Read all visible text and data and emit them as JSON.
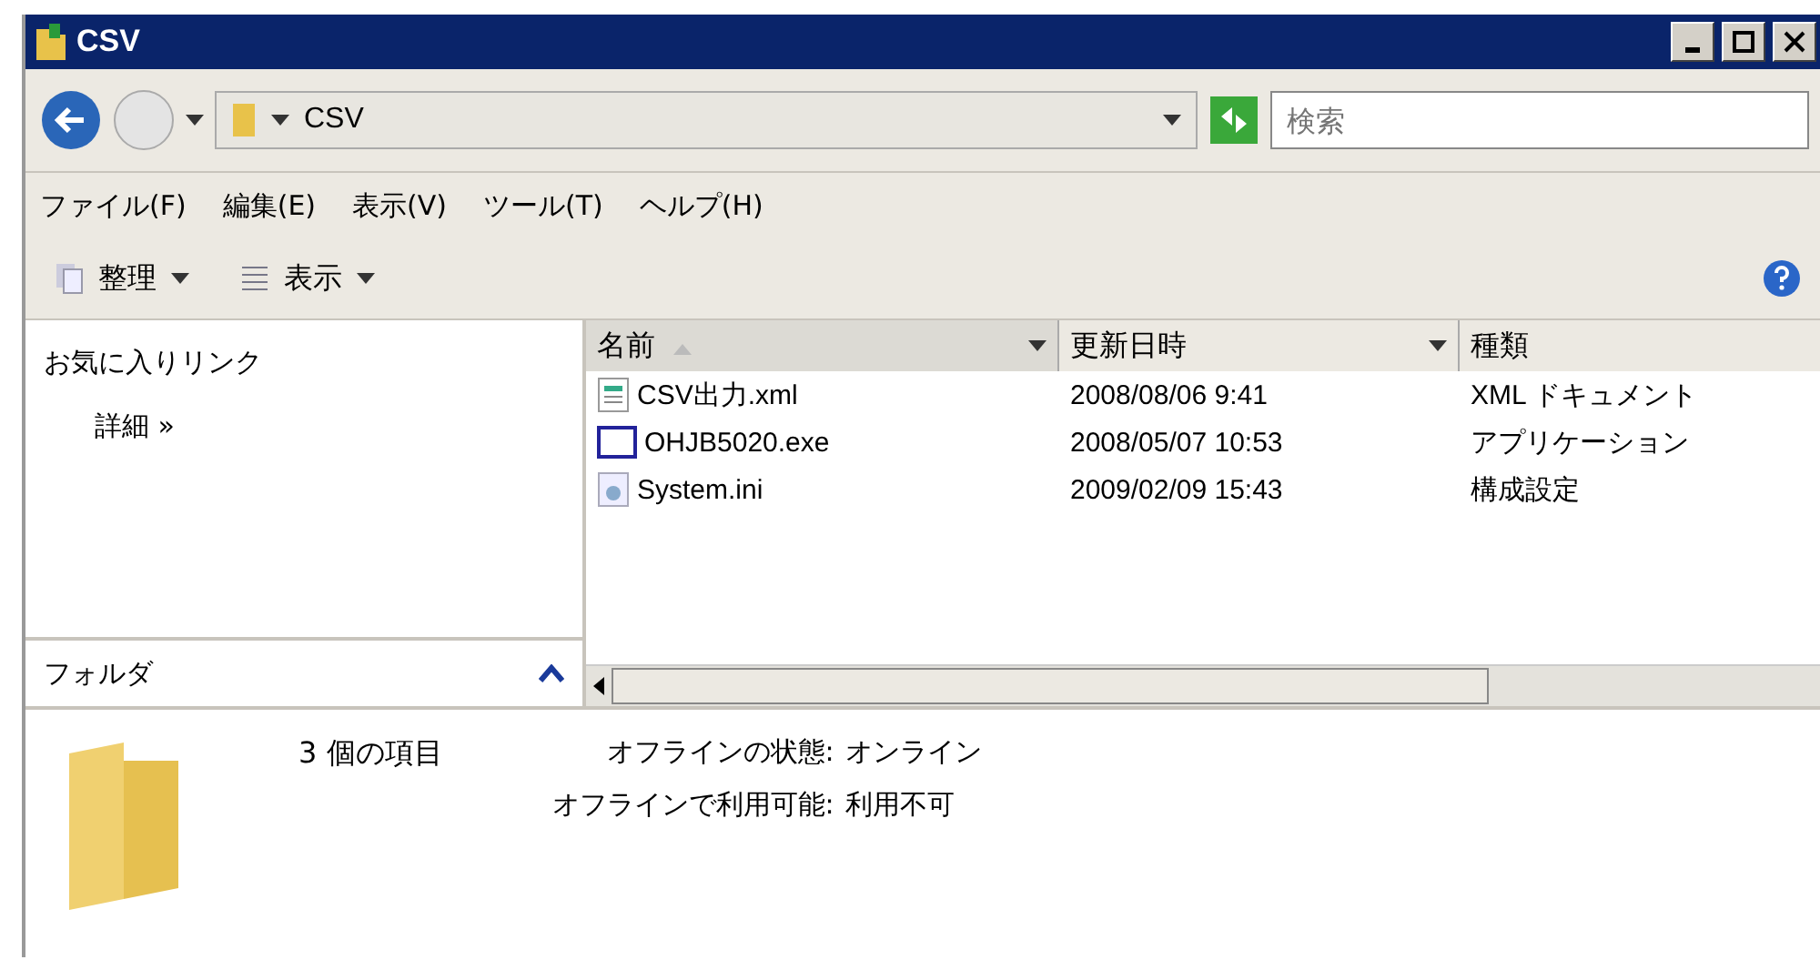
{
  "window": {
    "title": "CSV"
  },
  "address": {
    "path": "CSV",
    "search_placeholder": "検索"
  },
  "menu": [
    "ファイル(F)",
    "編集(E)",
    "表示(V)",
    "ツール(T)",
    "ヘルプ(H)"
  ],
  "toolbar": [
    {
      "label": "整理",
      "kind": "organize"
    },
    {
      "label": "表示",
      "kind": "views"
    }
  ],
  "favorites": {
    "title": "お気に入りリンク",
    "links": [
      {
        "label": "詳細",
        "chevron": "»"
      }
    ]
  },
  "folders": {
    "title": "フォルダ",
    "expanded": true
  },
  "table": {
    "columns": [
      {
        "label": "名前",
        "sorted": true
      },
      {
        "label": "更新日時",
        "sorted": false
      },
      {
        "label": "種類",
        "sorted": false
      }
    ],
    "rows": [
      {
        "kind": "xml",
        "name": "CSV出力.xml",
        "modified": "2008/08/06 9:41",
        "type": "XML ドキュメント"
      },
      {
        "kind": "exe",
        "name": "OHJB5020.exe",
        "modified": "2008/05/07 10:53",
        "type": "アプリケーション"
      },
      {
        "kind": "ini",
        "name": "System.ini",
        "modified": "2009/02/09 15:43",
        "type": "構成設定"
      }
    ]
  },
  "details": {
    "count": "3 個の項目",
    "properties": [
      {
        "label": "オフラインの状態:",
        "value": "オンライン"
      },
      {
        "label": "オフラインで利用可能:",
        "value": "利用不可"
      }
    ]
  }
}
